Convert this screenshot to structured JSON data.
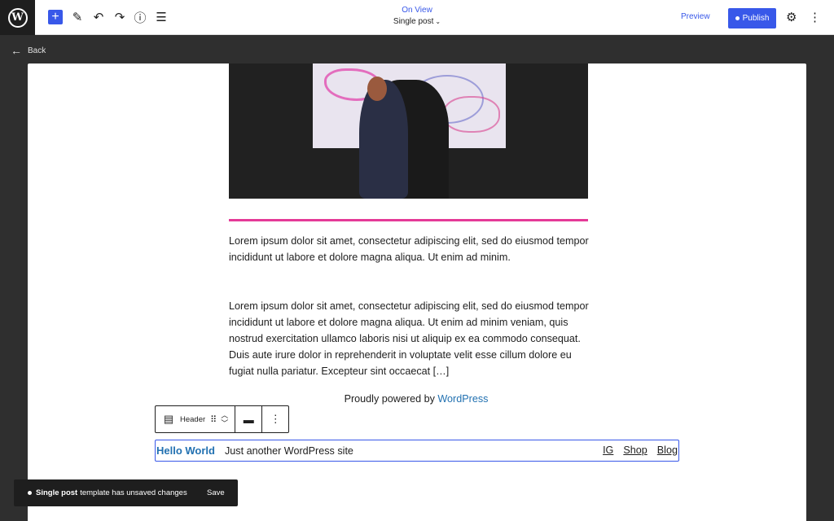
{
  "header": {
    "on_view": "On View",
    "doc_title": "Single post",
    "preview_label": "Preview",
    "publish_label": "Publish"
  },
  "nav": {
    "back_label": "Back"
  },
  "content": {
    "paragraph_1": "Lorem ipsum dolor sit amet, consectetur adipiscing elit, sed do eiusmod tempor incididunt ut labore et dolore magna aliqua. Ut enim ad minim.",
    "paragraph_2": "Lorem ipsum dolor sit amet, consectetur adipiscing elit, sed do eiusmod tempor incididunt ut labore et dolore magna aliqua. Ut enim ad minim veniam, quis nostrud exercitation ullamco laboris nisi ut aliquip ex ea commodo consequat. Duis aute irure dolor in reprehenderit in voluptate velit esse cillum dolore eu fugiat nulla pariatur. Excepteur sint occaecat […]",
    "powered_prefix": "Proudly powered by ",
    "powered_link": "WordPress"
  },
  "block_toolbar": {
    "block_label": "Header"
  },
  "site_header": {
    "site_title": "Hello World",
    "tagline": "Just another WordPress site",
    "nav_items": [
      "IG",
      "Shop",
      "Blog"
    ]
  },
  "snackbar": {
    "bold": "Single post",
    "message": "template has unsaved changes",
    "action": "Save"
  },
  "colors": {
    "accent": "#3858e9",
    "link": "#2271b1",
    "separator": "#e53a97",
    "frame": "#2f2f2f"
  }
}
